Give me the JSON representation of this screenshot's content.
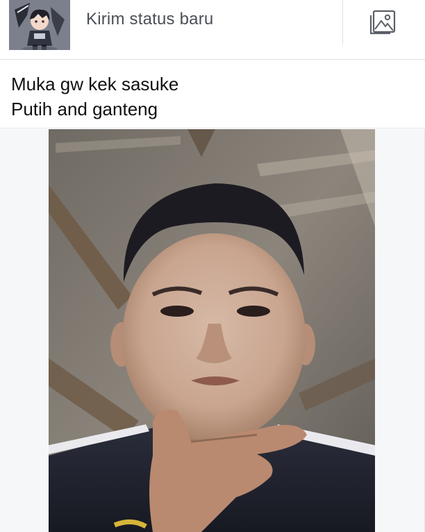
{
  "composer": {
    "placeholder": "Kirim status baru",
    "avatar_icon": "anime-character-avatar",
    "photo_icon": "photo-icon"
  },
  "post": {
    "lines": [
      "Muka gw kek sasuke",
      "Putih and ganteng"
    ]
  },
  "photo": {
    "subject": "selfie-photo"
  },
  "colors": {
    "background": "#ffffff",
    "divider": "#dddfe2",
    "placeholder_text": "#4b4f56",
    "post_text": "#111111",
    "photo_backdrop": "#f6f7f9"
  }
}
